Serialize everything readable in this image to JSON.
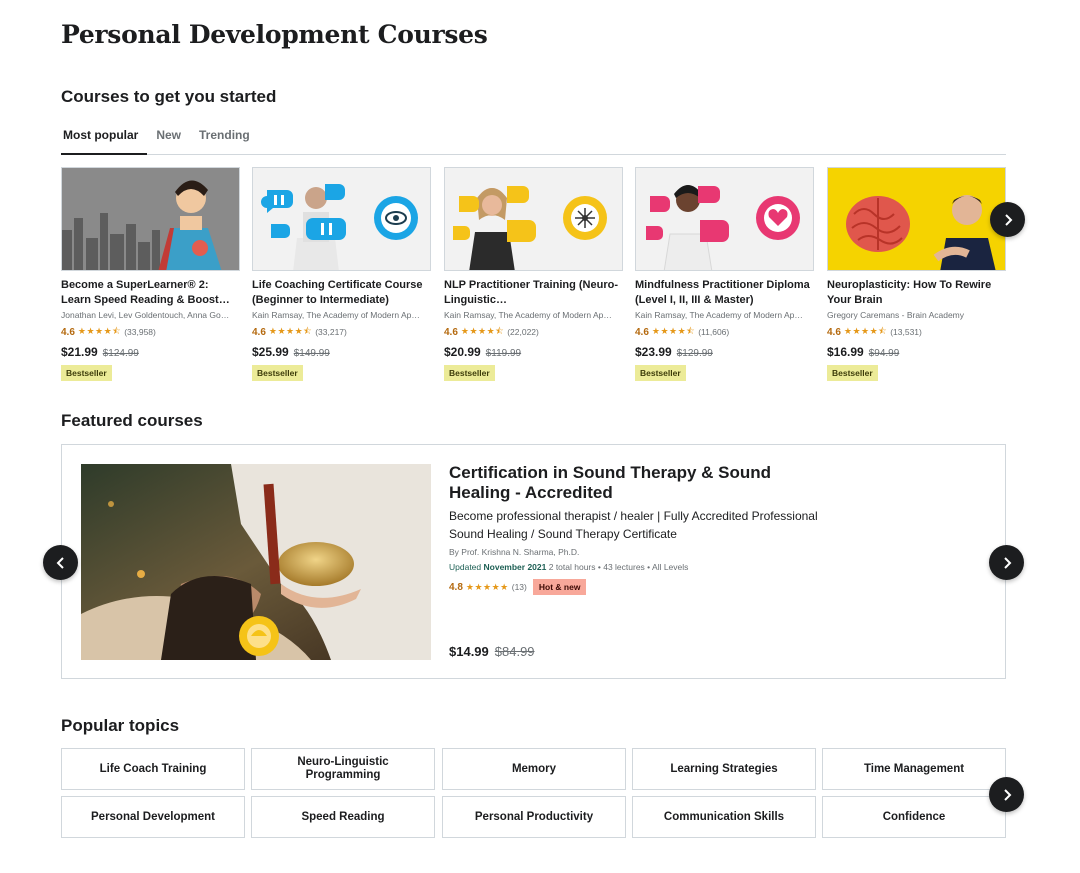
{
  "page": {
    "title": "Personal Development Courses"
  },
  "started": {
    "heading": "Courses to get you started",
    "tabs": [
      {
        "label": "Most popular",
        "active": true
      },
      {
        "label": "New",
        "active": false
      },
      {
        "label": "Trending",
        "active": false
      }
    ],
    "courses": [
      {
        "title": "Become a SuperLearner® 2: Learn Speed Reading & Boost…",
        "author": "Jonathan Levi, Lev Goldentouch, Anna Go…",
        "rating": "4.6",
        "stars": "★★★★⯪",
        "count": "(33,958)",
        "price": "$21.99",
        "old_price": "$124.99",
        "badge": "Bestseller"
      },
      {
        "title": "Life Coaching Certificate Course (Beginner to Intermediate)",
        "author": "Kain Ramsay, The Academy of Modern Ap…",
        "rating": "4.6",
        "stars": "★★★★⯪",
        "count": "(33,217)",
        "price": "$25.99",
        "old_price": "$149.99",
        "badge": "Bestseller"
      },
      {
        "title": "NLP Practitioner Training (Neuro-Linguistic…",
        "author": "Kain Ramsay, The Academy of Modern Ap…",
        "rating": "4.6",
        "stars": "★★★★⯪",
        "count": "(22,022)",
        "price": "$20.99",
        "old_price": "$119.99",
        "badge": "Bestseller"
      },
      {
        "title": "Mindfulness Practitioner Diploma (Level I, II, III & Master)",
        "author": "Kain Ramsay, The Academy of Modern Ap…",
        "rating": "4.6",
        "stars": "★★★★⯪",
        "count": "(11,606)",
        "price": "$23.99",
        "old_price": "$129.99",
        "badge": "Bestseller"
      },
      {
        "title": "Neuroplasticity: How To Rewire Your Brain",
        "author": "Gregory Caremans - Brain Academy",
        "rating": "4.6",
        "stars": "★★★★⯪",
        "count": "(13,531)",
        "price": "$16.99",
        "old_price": "$94.99",
        "badge": "Bestseller"
      }
    ]
  },
  "featured": {
    "heading": "Featured courses",
    "title": "Certification in Sound Therapy & Sound Healing - Accredited",
    "description": "Become professional therapist / healer | Fully Accredited Professional Sound Healing / Sound Therapy Certificate",
    "author": "By Prof. Krishna N. Sharma, Ph.D.",
    "updated_label": "Updated",
    "updated_date": "November 2021",
    "meta": "2 total hours • 43 lectures • All Levels",
    "rating": "4.8",
    "stars": "★★★★★",
    "count": "(13)",
    "badge": "Hot & new",
    "price": "$14.99",
    "old_price": "$84.99"
  },
  "topics": {
    "heading": "Popular topics",
    "items": [
      "Life Coach Training",
      "Neuro-Linguistic Programming",
      "Memory",
      "Learning Strategies",
      "Time Management",
      "Personal Development",
      "Speed Reading",
      "Personal Productivity",
      "Communication Skills",
      "Confidence"
    ]
  },
  "colors": {
    "bestseller_badge": "#eceb98",
    "hot_badge": "#f8a89a",
    "rating": "#b4690e",
    "star": "#e59819",
    "updated": "#1e6055"
  },
  "icons": {
    "next": "chevron-right-icon",
    "prev": "chevron-left-icon"
  }
}
